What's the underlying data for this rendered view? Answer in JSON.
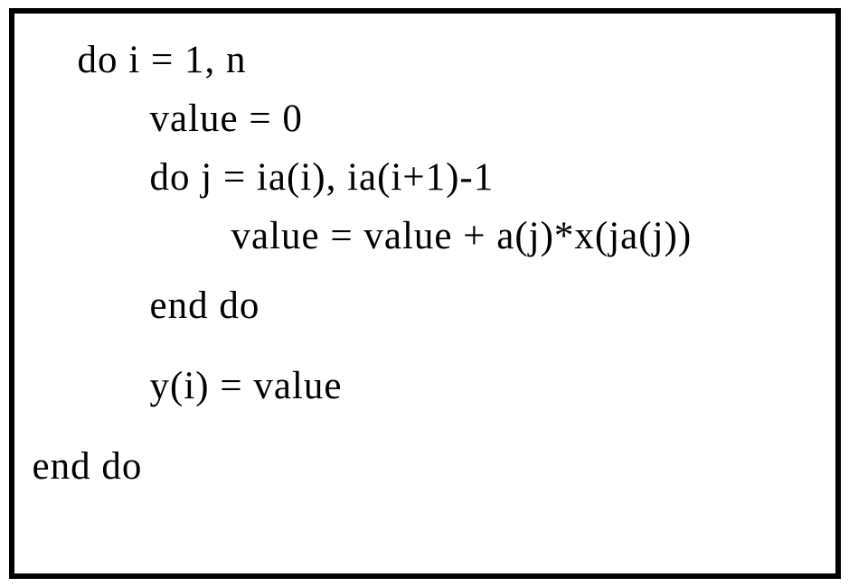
{
  "code": {
    "line1": "do i = 1, n",
    "line2": "value = 0",
    "line3": "do j = ia(i), ia(i+1)-1",
    "line4": "value = value + a(j)*x(ja(j))",
    "line5": "end do",
    "line6": "y(i) = value",
    "line7": "end do"
  }
}
